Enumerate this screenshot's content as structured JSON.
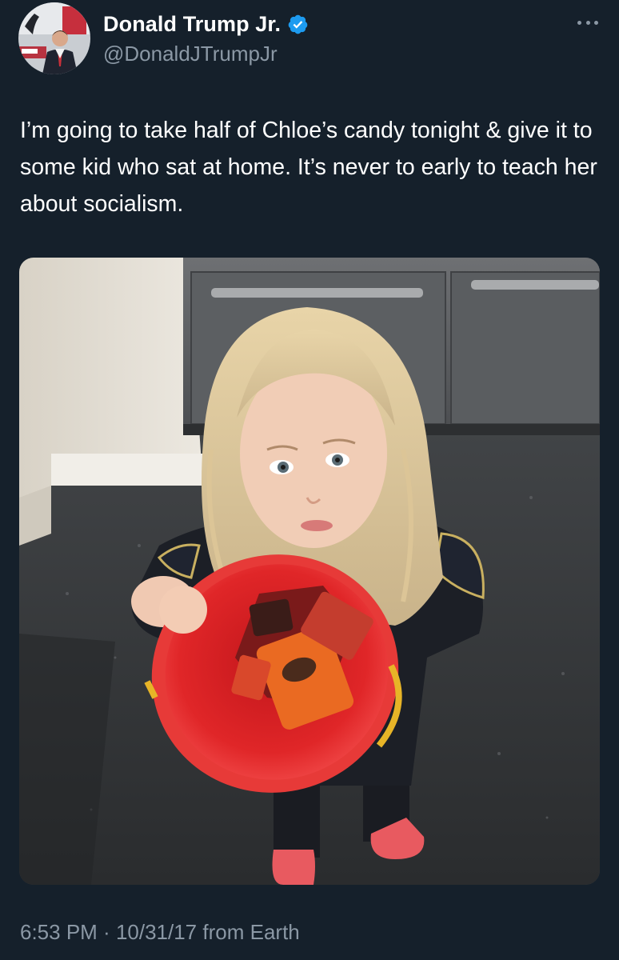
{
  "author": {
    "display_name": "Donald Trump Jr.",
    "handle": "@DonaldJTrumpJr",
    "verified": true
  },
  "tweet": {
    "text": "I’m going to take half of Chloe’s candy tonight & give it to some kid who sat at home. It’s never to early to teach her about socialism."
  },
  "meta": {
    "time": "6:53 PM",
    "separator1": " · ",
    "date": "10/31/17",
    "source": " from Earth"
  },
  "colors": {
    "background": "#15202b",
    "text": "#ffffff",
    "secondary_text": "#8b98a5",
    "verified_badge": "#1d9bf0"
  },
  "icons": {
    "verified": "verified-badge-icon",
    "more": "more-options-icon"
  }
}
